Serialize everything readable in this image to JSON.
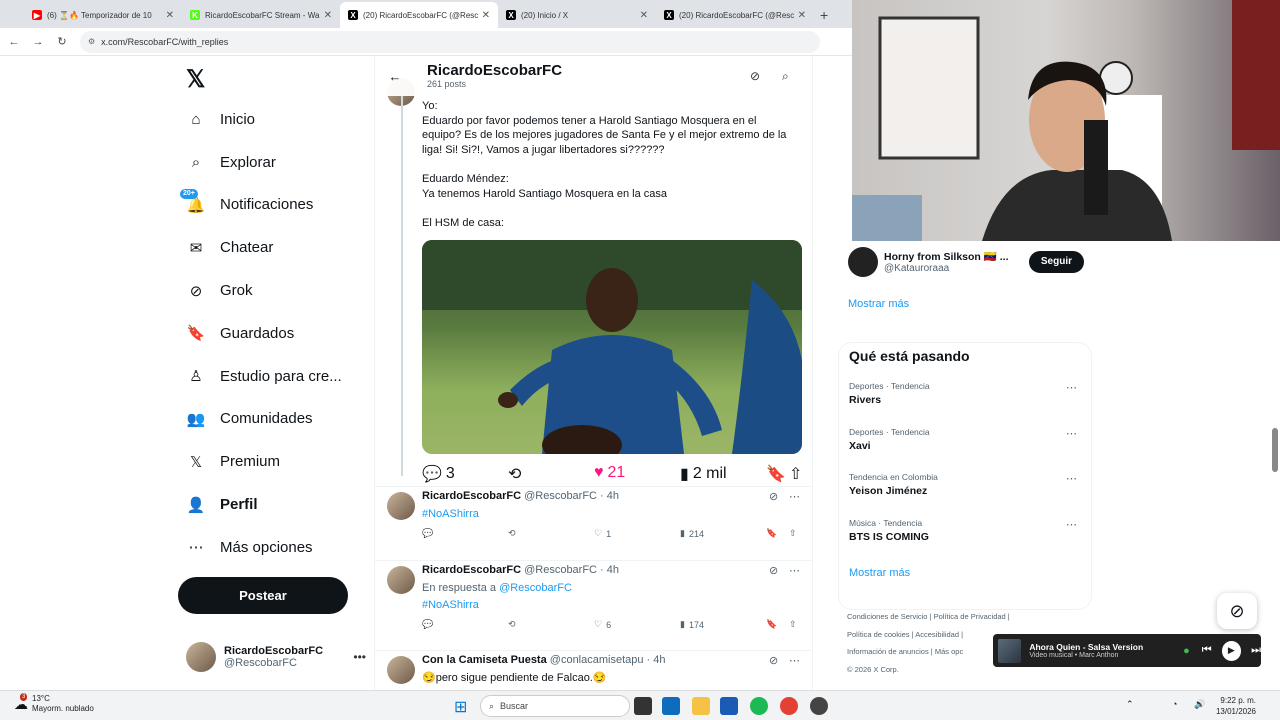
{
  "browser": {
    "tabs": [
      {
        "title": "(6) ⏳🔥 Temporizador de 10",
        "icon": "youtube-icon",
        "color": "#ff0000",
        "active": false
      },
      {
        "title": "RicardoEscobarFC Stream - Wa",
        "icon": "kick-icon",
        "color": "#53fc18",
        "active": false
      },
      {
        "title": "(20) RicardoEscobarFC (@Resc",
        "icon": "x-icon",
        "color": "#000000",
        "active": true
      },
      {
        "title": "(20) Inicio / X",
        "icon": "x-icon",
        "color": "#000000",
        "active": false
      },
      {
        "title": "(20) RicardoEscobarFC (@Resc",
        "icon": "x-icon",
        "color": "#000000",
        "active": false
      }
    ],
    "url": "x.com/RescobarFC/with_replies"
  },
  "nav": {
    "items": [
      {
        "label": "Inicio",
        "icon": "home-icon"
      },
      {
        "label": "Explorar",
        "icon": "search-icon"
      },
      {
        "label": "Notificaciones",
        "icon": "bell-icon",
        "badge": "20+"
      },
      {
        "label": "Chatear",
        "icon": "mail-icon"
      },
      {
        "label": "Grok",
        "icon": "grok-icon"
      },
      {
        "label": "Guardados",
        "icon": "bookmark-icon"
      },
      {
        "label": "Estudio para cre...",
        "icon": "studio-icon"
      },
      {
        "label": "Comunidades",
        "icon": "communities-icon"
      },
      {
        "label": "Premium",
        "icon": "x-premium-icon"
      },
      {
        "label": "Perfil",
        "icon": "person-icon"
      },
      {
        "label": "Más opciones",
        "icon": "more-circle-icon"
      }
    ],
    "post_button": "Postear",
    "account": {
      "name": "RicardoEscobarFC",
      "handle": "@RescobarFC"
    }
  },
  "profile_header": {
    "name": "RicardoEscobarFC",
    "posts_count": "261 posts"
  },
  "main_post": {
    "text": "Yo:\nEduardo por favor podemos tener a Harold Santiago Mosquera en el equipo? Es de los mejores jugadores de Santa Fe y el mejor extremo de la liga! Si! Si?!, Vamos a jugar libertadores si??????\n\nEduardo Méndez:\nYa tenemos Harold Santiago Mosquera en la casa\n\nEl HSM de casa:",
    "replies": "3",
    "likes": "21",
    "views": "2 mil"
  },
  "tweets": [
    {
      "name": "RicardoEscobarFC",
      "handle": "@RescobarFC · 4h",
      "reply_to": "",
      "reply_prefix": "",
      "text": "#NoAShirra",
      "likes": "1",
      "views": "214"
    },
    {
      "name": "RicardoEscobarFC",
      "handle": "@RescobarFC · 4h",
      "reply_prefix": "En respuesta a ",
      "reply_to": "@RescobarFC",
      "text": "#NoAShirra",
      "likes": "6",
      "views": "174"
    },
    {
      "name": "Con la Camiseta Puesta",
      "handle": "@conlacamisetapu · 4h",
      "reply_prefix": "",
      "reply_to": "",
      "text": "😏pero sigue pendiente de Falcao.😏"
    }
  ],
  "right": {
    "suggest": {
      "name": "Horny from Silkson 🇻🇪 ...",
      "handle": "@Katauroraaa",
      "follow": "Seguir"
    },
    "show_more": "Mostrar más",
    "trends_title": "Qué está pasando",
    "trends": [
      {
        "category": "Deportes · Tendencia",
        "name": "Rivers"
      },
      {
        "category": "Deportes · Tendencia",
        "name": "Xavi"
      },
      {
        "category": "Tendencia en Colombia",
        "name": "Yeison Jiménez"
      },
      {
        "category": "Música · Tendencia",
        "name": "BTS IS COMING"
      }
    ],
    "footer": {
      "terms": "Condiciones de Servicio",
      "privacy": "Política de Privacidad",
      "cookies": "Política de cookies",
      "access": "Accesibilidad",
      "ads": "Información de anuncios",
      "more": "Más opc",
      "copyright": "© 2026 X Corp."
    }
  },
  "player": {
    "title": "Ahora Quien - Salsa Version",
    "subtitle": "Video musical • Marc Anthon"
  },
  "taskbar": {
    "temp": "13°C",
    "weather": "Mayorm. nublado",
    "weather_badge": "3",
    "search": "Buscar",
    "time": "9:22 p. m.",
    "date": "13/01/2026"
  }
}
